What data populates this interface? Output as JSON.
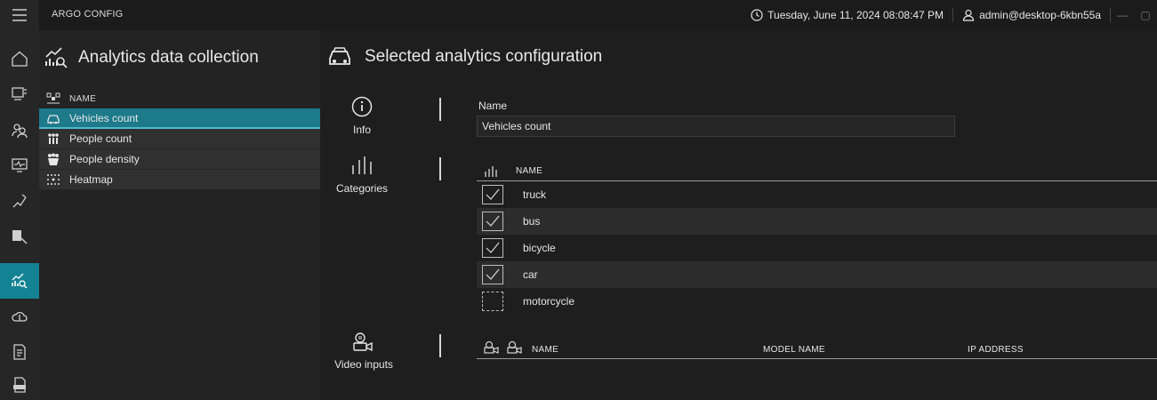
{
  "app": {
    "title": "ARGO CONFIG"
  },
  "titlebar": {
    "datetime": "Tuesday, June 11, 2024 08:08:47 PM",
    "user": "admin@desktop-6kbn55a",
    "minimize_glyph": "—",
    "restore_glyph": "▢"
  },
  "rail": {
    "icons": [
      "menu-icon",
      "home-icon",
      "devices-icon",
      "users-icon",
      "monitor-icon",
      "rules-icon",
      "camera-edit-icon",
      "analytics-icon",
      "cloud-icon",
      "report-icon",
      "log-icon"
    ],
    "active_index": 7
  },
  "list_panel": {
    "title": "Analytics data collection",
    "column_header": "NAME",
    "items": [
      {
        "label": "Vehicles count",
        "icon": "vehicles-icon",
        "selected": true
      },
      {
        "label": "People count",
        "icon": "people-icon",
        "selected": false
      },
      {
        "label": "People density",
        "icon": "people-density-icon",
        "selected": false
      },
      {
        "label": "Heatmap",
        "icon": "heatmap-icon",
        "selected": false
      }
    ]
  },
  "main": {
    "title": "Selected analytics configuration",
    "sections": {
      "info": "Info",
      "categories": "Categories",
      "video_inputs": "Video inputs"
    },
    "name_label": "Name",
    "name_value": "Vehicles count",
    "categories_header": "NAME",
    "categories": [
      {
        "label": "truck",
        "checked": true
      },
      {
        "label": "bus",
        "checked": true
      },
      {
        "label": "bicycle",
        "checked": true
      },
      {
        "label": "car",
        "checked": true
      },
      {
        "label": "motorcycle",
        "checked": false
      }
    ],
    "video_columns": {
      "name": "NAME",
      "model": "MODEL NAME",
      "ip": "IP ADDRESS"
    }
  },
  "colors": {
    "accent": "#138293",
    "selected_row": "#1c7a8a",
    "background": "#1e1e1e"
  }
}
